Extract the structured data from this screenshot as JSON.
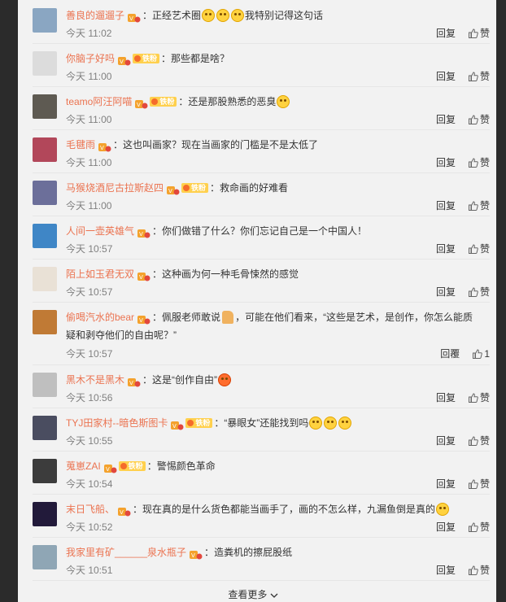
{
  "comments": [
    {
      "user": "善良的遛遛子",
      "fan_badge": "",
      "sep": "：",
      "pre": "正经艺术圈",
      "emoji": 3,
      "post": "我特别记得这句话",
      "time": "今天 11:02",
      "reply": "回复",
      "like": "赞",
      "avatar": "#8aa6c2"
    },
    {
      "user": "你脑子好吗",
      "fan_badge": "铁粉",
      "sep": "：",
      "pre": "那些都是啥？",
      "emoji": 0,
      "post": "",
      "time": "今天 11:00",
      "reply": "回复",
      "like": "赞",
      "avatar": "#dcdcdc"
    },
    {
      "user": "teamo阿汪阿喵",
      "fan_badge": "铁粉",
      "sep": "：",
      "pre": "还是那股熟悉的恶臭",
      "emoji": 1,
      "post": "",
      "time": "今天 11:00",
      "reply": "回复",
      "like": "赞",
      "avatar": "#5e5a52"
    },
    {
      "user": "毛毽雨",
      "fan_badge": "",
      "sep": "：",
      "pre": "这也叫画家？现在当画家的门槛是不是太低了",
      "emoji": 0,
      "post": "",
      "time": "今天 11:00",
      "reply": "回复",
      "like": "赞",
      "avatar": "#b2475a"
    },
    {
      "user": "马猴烧酒尼古拉斯赵四",
      "fan_badge": "铁粉",
      "sep": "：",
      "pre": "救命画的好难看",
      "emoji": 0,
      "post": "",
      "time": "今天 11:00",
      "reply": "回复",
      "like": "赞",
      "avatar": "#6c6f9a"
    },
    {
      "user": "人间一壶英雄气",
      "fan_badge": "",
      "sep": "：",
      "pre": "你们做错了什么？你们忘记自己是一个中国人！",
      "emoji": 0,
      "post": "",
      "time": "今天 10:57",
      "reply": "回复",
      "like": "赞",
      "avatar": "#3f86c6"
    },
    {
      "user": "陌上如玉君无双",
      "fan_badge": "",
      "sep": "：",
      "pre": "这种画为何一种毛骨悚然的感觉",
      "emoji": 0,
      "post": "",
      "time": "今天 10:57",
      "reply": "回复",
      "like": "赞",
      "avatar": "#e9e1d6"
    },
    {
      "user": "偷喝汽水的bear",
      "fan_badge": "",
      "sep": "：",
      "pre": "佩服老师敢说",
      "thumb": true,
      "post": "，可能在他们看来，“这些是艺术，是创作，你怎么能质疑和剥夺他们的自由呢？”",
      "time": "今天 10:57",
      "reply": "回覆",
      "like": "1",
      "avatar": "#c07a35"
    },
    {
      "user": "黑木不是黑木",
      "fan_badge": "",
      "sep": "：",
      "pre": "这是“创作自由”",
      "angry": true,
      "post": "",
      "time": "今天 10:56",
      "reply": "回复",
      "like": "赞",
      "avatar": "#bfbfbf"
    },
    {
      "user": "TYJ田家村--暗色斯图卡",
      "fan_badge": "铁粉",
      "sep": "：",
      "pre": "“暴眼女”还能找到吗",
      "emoji": 3,
      "post": "",
      "time": "今天 10:55",
      "reply": "回复",
      "like": "赞",
      "avatar": "#4a4d60"
    },
    {
      "user": "蒐崽ZAI",
      "fan_badge": "铁粉",
      "sep": "：",
      "pre": "警惕颜色革命",
      "emoji": 0,
      "post": "",
      "time": "今天 10:54",
      "reply": "回复",
      "like": "赞",
      "avatar": "#3c3c3c"
    },
    {
      "user": "末日飞船、",
      "fan_badge": "",
      "sep": "：",
      "pre": "现在真的是什么货色都能当画手了，画的不怎么样，九漏鱼倒是真的",
      "sob": true,
      "post": "",
      "time": "今天 10:52",
      "reply": "回复",
      "like": "赞",
      "avatar": "#221a3a"
    },
    {
      "user": "我家里有矿______泉水瓶子",
      "fan_badge": "",
      "sep": "：",
      "pre": "造粪机的擦屁股纸",
      "emoji": 0,
      "post": "",
      "time": "今天 10:51",
      "reply": "回复",
      "like": "赞",
      "avatar": "#8fa6b5"
    }
  ],
  "more_label": "查看更多",
  "icons": {
    "like": "thumb-up-icon",
    "vip": "vip-badge-icon",
    "more": "chevron-down-icon"
  }
}
